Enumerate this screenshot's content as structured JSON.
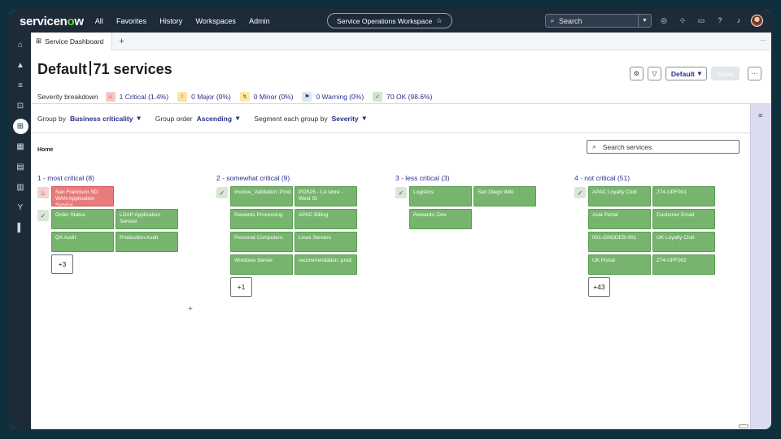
{
  "app": {
    "brand": "servicenow",
    "nav": [
      "All",
      "Favorites",
      "History",
      "Workspaces",
      "Admin"
    ],
    "workspace_title": "Service Operations Workspace",
    "search_placeholder": "Search"
  },
  "tabs": [
    {
      "label": "Service Dashboard"
    }
  ],
  "header": {
    "title": "Default",
    "subtitle": "71 services",
    "severity_label": "Severity breakdown",
    "severities": [
      {
        "label": "1 Critical (1.4%)",
        "icon": "critical-icon",
        "color": "#f3c7c7"
      },
      {
        "label": "0 Major (0%)",
        "icon": "major-icon",
        "color": "#fbe2a7"
      },
      {
        "label": "0 Minor (0%)",
        "icon": "minor-icon",
        "color": "#fbe9a0"
      },
      {
        "label": "0 Warning (0%)",
        "icon": "warning-icon",
        "color": "#dbe6f3"
      },
      {
        "label": "70 OK (98.6%)",
        "icon": "ok-icon",
        "color": "#cfe6c9"
      }
    ],
    "default_label": "Default",
    "save_label": "Save"
  },
  "toolbar": {
    "group_by_label": "Group by",
    "group_by_value": "Business criticality",
    "group_order_label": "Group order",
    "group_order_value": "Ascending",
    "segment_label": "Segment each group by",
    "segment_value": "Severity"
  },
  "content": {
    "breadcrumb": "Home",
    "search_placeholder": "Search services",
    "groups": [
      {
        "title": "1 - most critical (8)",
        "rows": [
          {
            "severity": "critical",
            "cards": [
              "San Francisco SD WAN Application Service"
            ]
          },
          {
            "severity": "ok",
            "cards": [
              "Order Status",
              "LDAP Application Service",
              "QA Audit",
              "Production Audit"
            ]
          }
        ],
        "more": "+3"
      },
      {
        "title": "2 - somewhat critical (9)",
        "rows": [
          {
            "severity": "ok",
            "cards": [
              "Invoice_Validation::Prod",
              "POS25 - LA store - West St",
              "Rewards Processing",
              "APAC Billing",
              "Personal Computers",
              "Linux Servers",
              "Windows Server",
              "recommendation::prod"
            ]
          }
        ],
        "more": "+1"
      },
      {
        "title": "3 - less critical (3)",
        "rows": [
          {
            "severity": "ok",
            "cards": [
              "Logistics",
              "San Diego Wiki",
              "Rewards::Dev"
            ]
          }
        ],
        "more": ""
      },
      {
        "title": "4 - not critical (51)",
        "rows": [
          {
            "severity": "ok",
            "cards": [
              "APAC Loyalty Club",
              "274-UPF001",
              "Asia Portal",
              "Customer Email",
              "001-GNODEB-001",
              "UK Loyalty Club",
              "UK Portal",
              "274-UPF002"
            ]
          }
        ],
        "more": "+43"
      }
    ]
  },
  "colors": {
    "topbar": "#1d2a38",
    "ok_card": "#77b56e",
    "critical_card": "#e97b7b",
    "accent": "#2a2f8a"
  }
}
